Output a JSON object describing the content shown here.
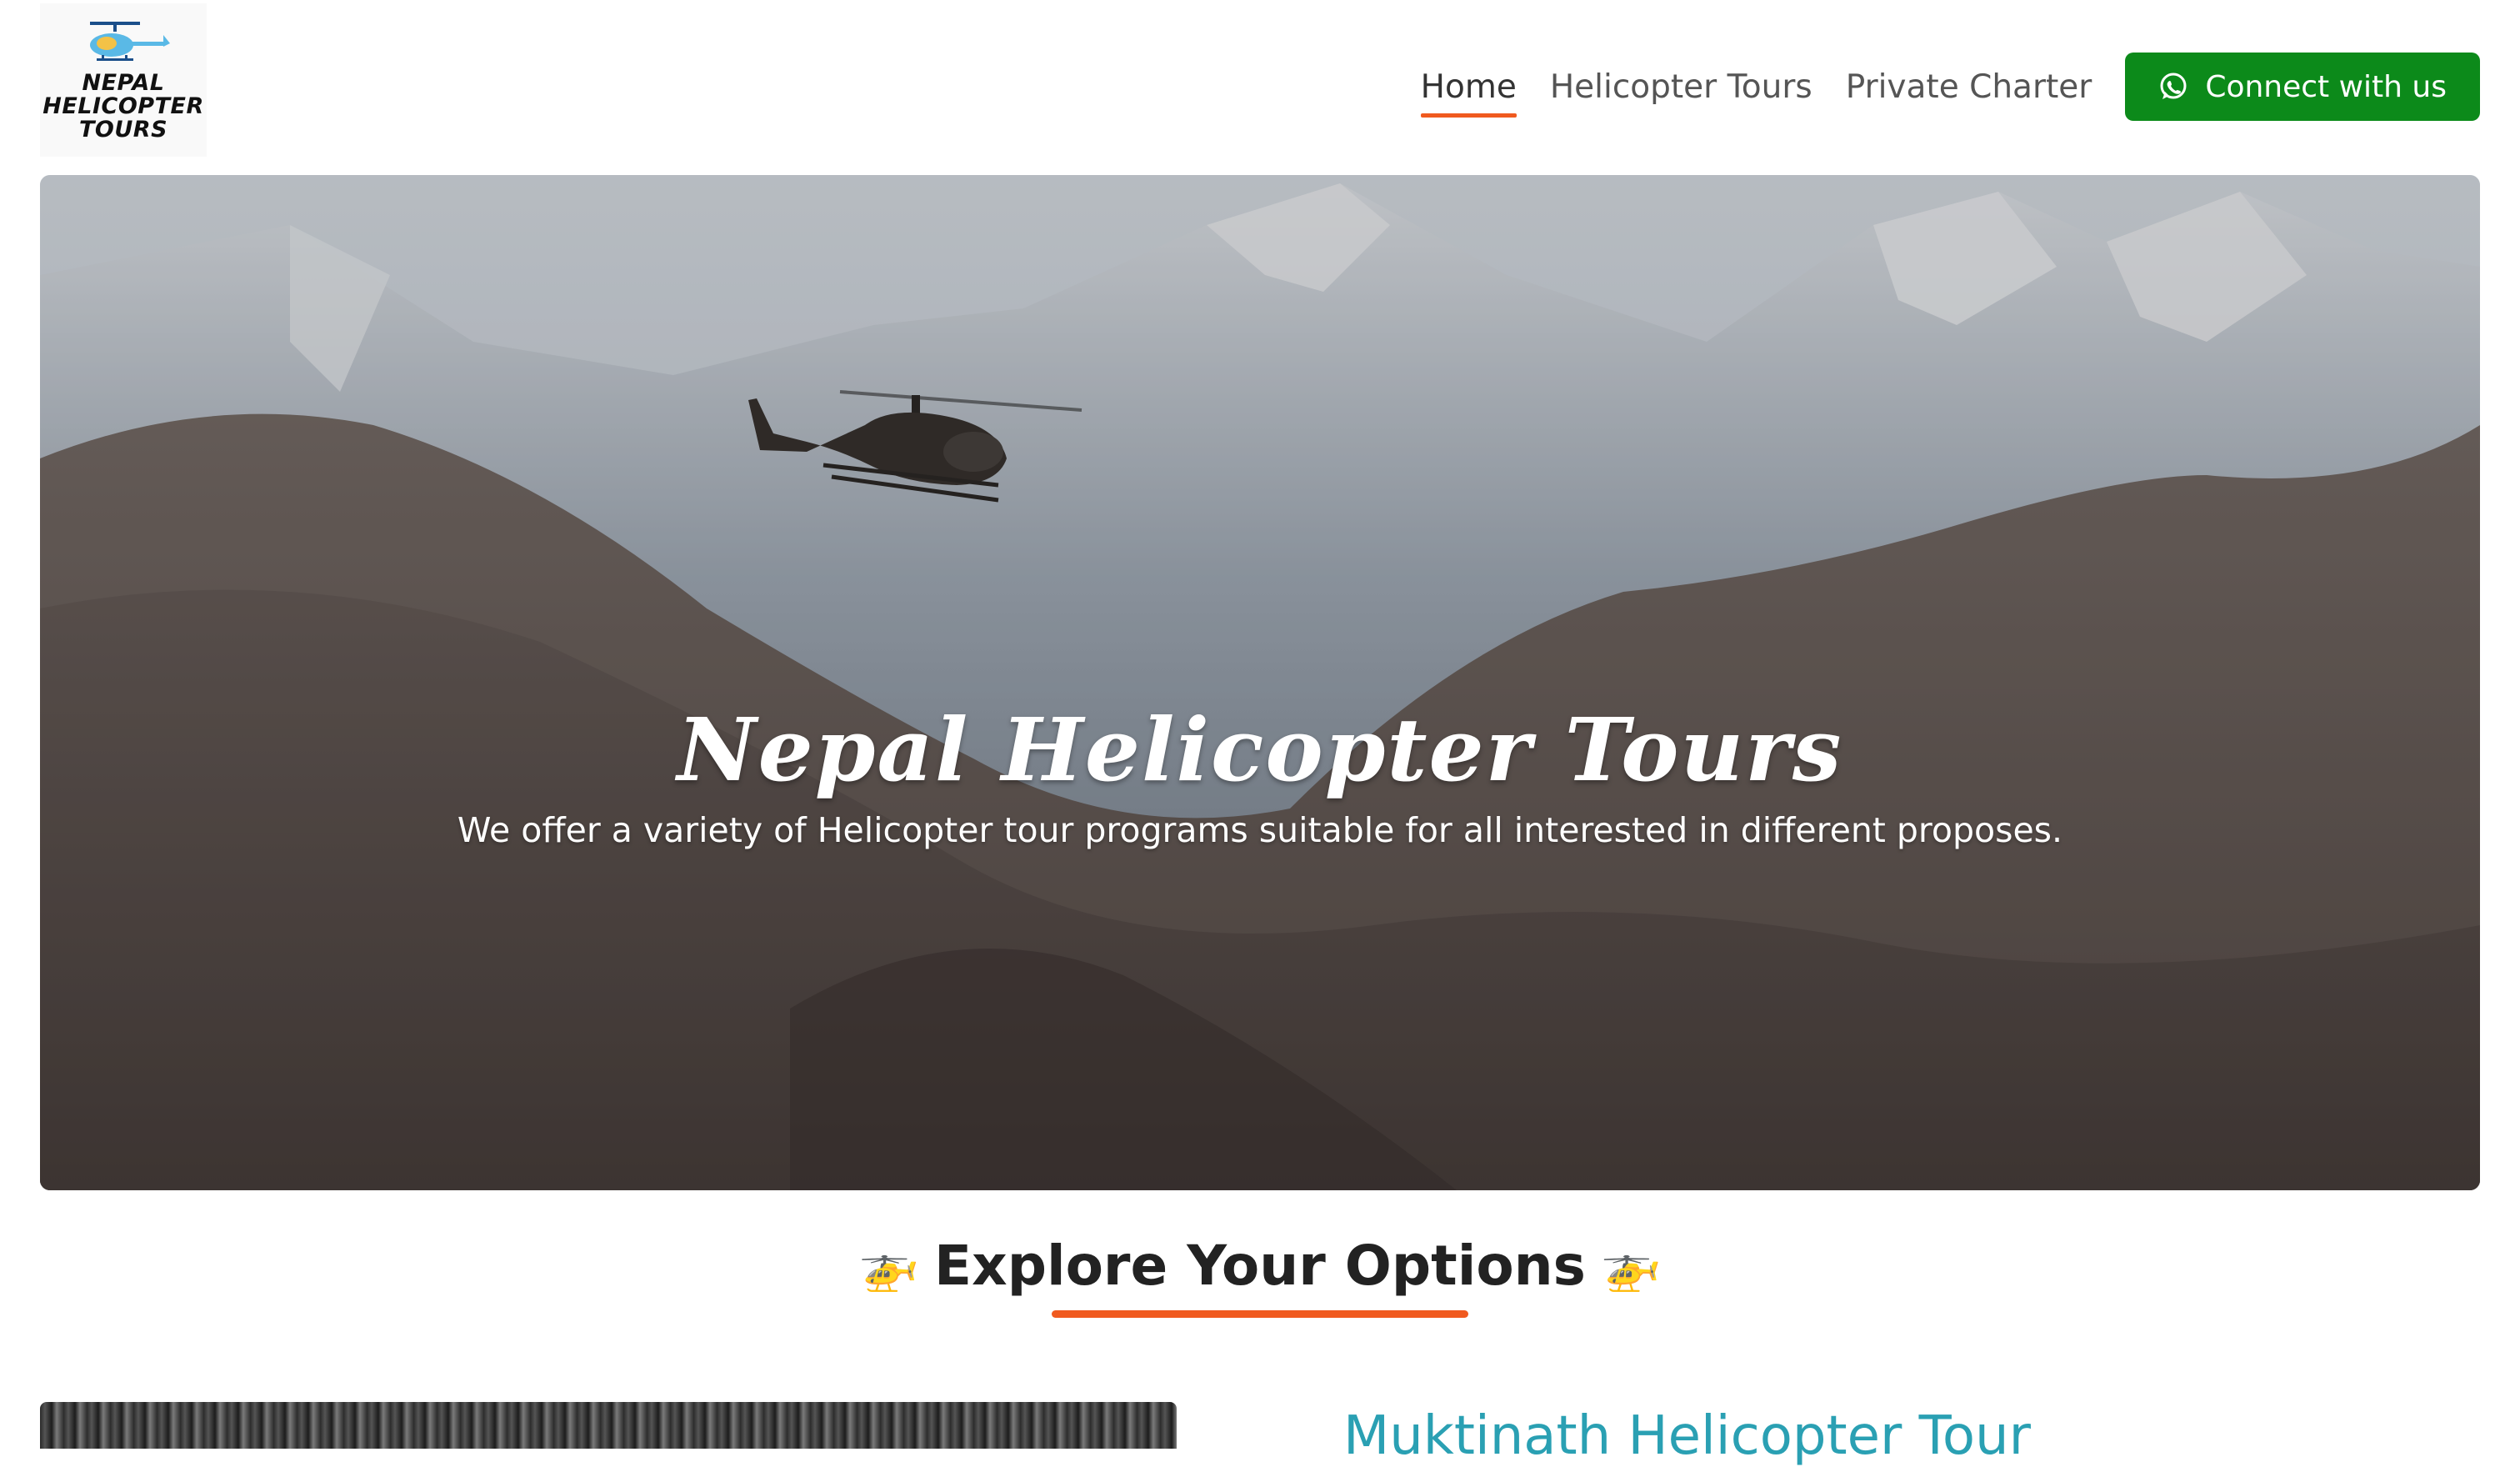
{
  "brand": {
    "logo_lines": [
      "NEPAL",
      "HELICOPTER",
      "TOURS"
    ]
  },
  "nav": {
    "items": [
      {
        "label": "Home",
        "active": true
      },
      {
        "label": "Helicopter Tours",
        "active": false
      },
      {
        "label": "Private Charter",
        "active": false
      }
    ],
    "cta_label": "Connect with us",
    "cta_icon": "whatsapp-icon",
    "cta_color": "#0c8a1a",
    "accent_color": "#f05a1f"
  },
  "hero": {
    "title": "Nepal Helicopter Tours",
    "subtitle": "We offer a variety of Helicopter tour programs suitable for all interested in different proposes."
  },
  "section": {
    "title": "Explore Your Options",
    "emoji": "🚁"
  },
  "card": {
    "title": "Muktinath Helicopter Tour",
    "title_color": "#2aa0b3"
  }
}
